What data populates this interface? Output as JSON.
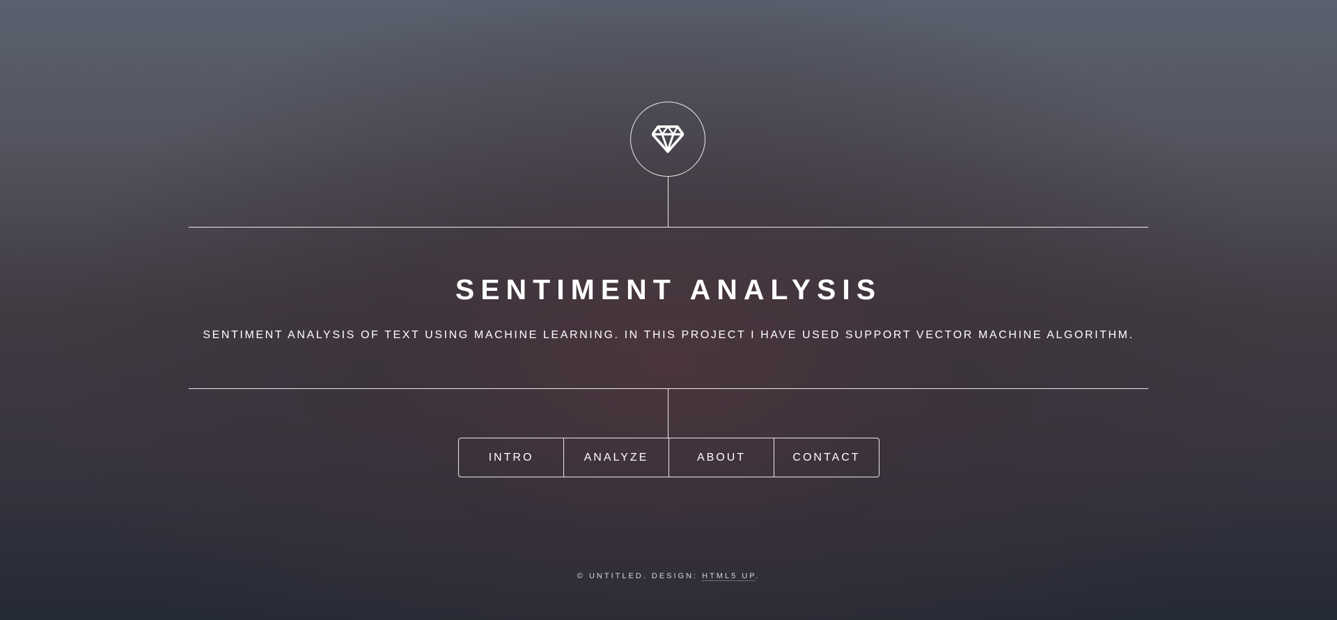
{
  "header": {
    "logo_icon": "diamond-icon",
    "title": "SENTIMENT ANALYSIS",
    "subtitle": "SENTIMENT ANALYSIS OF TEXT USING MACHINE LEARNING. IN THIS PROJECT I HAVE USED SUPPORT VECTOR MACHINE ALGORITHM."
  },
  "nav": {
    "items": [
      {
        "label": "INTRO"
      },
      {
        "label": "ANALYZE"
      },
      {
        "label": "ABOUT"
      },
      {
        "label": "CONTACT"
      }
    ]
  },
  "footer": {
    "copyright": "© UNTITLED. DESIGN: ",
    "design_link": "HTML5 UP",
    "trailing": "."
  },
  "colors": {
    "text": "#ffffff",
    "bg_top": "#59616e",
    "bg_bottom": "#242a36"
  }
}
